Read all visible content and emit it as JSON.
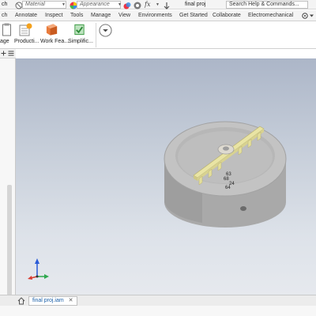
{
  "qat": {
    "material_placeholder": "Material",
    "appearance_placeholder": "Appearance",
    "doc_title": "final proj",
    "search": "Search Help & Commands..."
  },
  "tabs": [
    "ch",
    "Annotate",
    "Inspect",
    "Tools",
    "Manage",
    "View",
    "Environments",
    "Get Started",
    "Collaborate",
    "Electromechanical"
  ],
  "ribbon": {
    "cut_label": "age",
    "productivity": "Producti...",
    "work_features": "Work Fea...",
    "simplification": "Simplific..."
  },
  "viewport": {
    "dims": [
      "63",
      "68",
      "24",
      "64"
    ]
  },
  "doc_tab": {
    "label": "final proj.iam",
    "close": "✕"
  },
  "colors": {
    "model_body": "#a9a9a9",
    "model_top": "#c3c3c3",
    "highlight_part": "#e9e4a4",
    "viewport_top": "#acb6c8",
    "viewport_bottom": "#e6e9ee"
  }
}
